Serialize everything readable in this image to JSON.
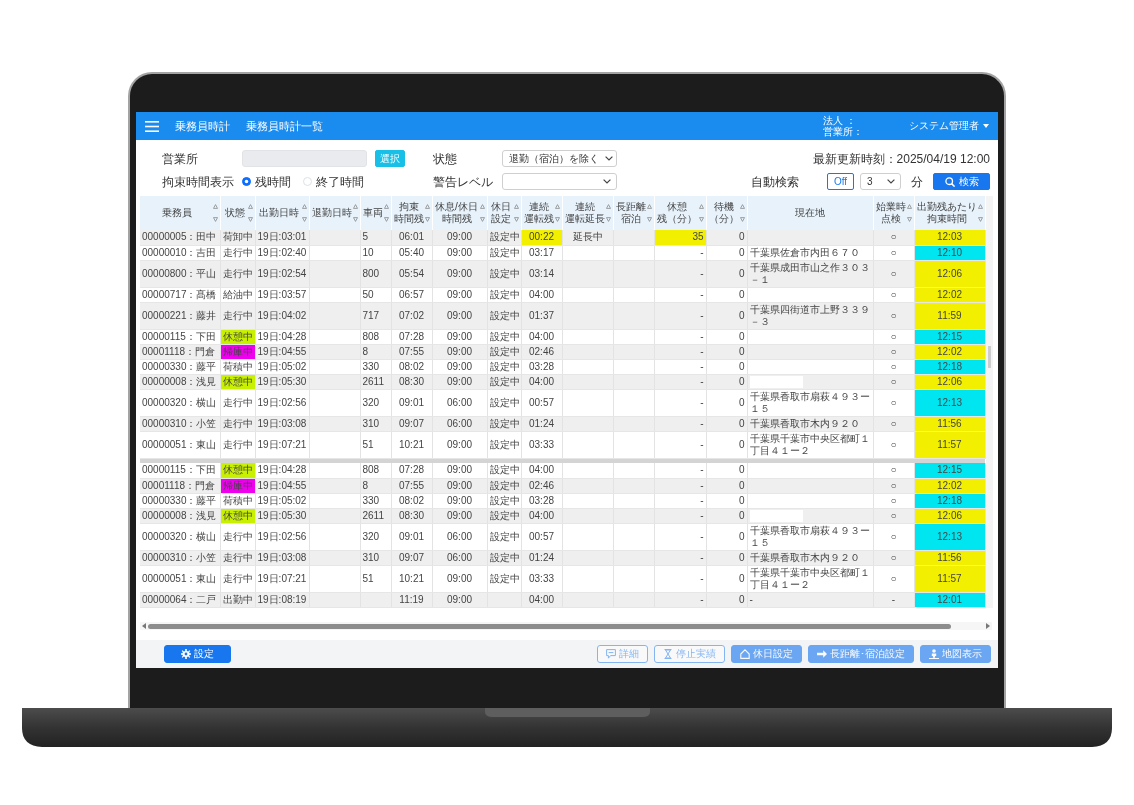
{
  "app_header": {
    "title": "乗務員時計",
    "page_title": "乗務員時計一覧",
    "corporation_label": "法人 ：",
    "office_label": "営業所：",
    "user": "システム管理者"
  },
  "filters": {
    "office": {
      "label": "営業所",
      "select_button": "選択"
    },
    "status": {
      "label": "状態",
      "value": "退勤（宿泊）を除く"
    },
    "last_updated": "最新更新時刻：2025/04/19 12:00",
    "time_display": {
      "label": "拘束時間表示",
      "options": [
        {
          "label": "残時間",
          "selected": true
        },
        {
          "label": "終了時間",
          "selected": false
        }
      ]
    },
    "warning_level": {
      "label": "警告レベル"
    },
    "auto_search": {
      "label": "自動検索",
      "toggle": {
        "label": "Off",
        "on": false
      },
      "interval": "3",
      "unit": "分"
    },
    "search_button": "検索"
  },
  "table": {
    "columns": [
      {
        "lines": [
          "乗務員"
        ],
        "sortable": true
      },
      {
        "lines": [
          "状態"
        ],
        "sortable": true
      },
      {
        "lines": [
          "出勤日時"
        ],
        "sortable": true
      },
      {
        "lines": [
          "退勤日時"
        ],
        "sortable": true
      },
      {
        "lines": [
          "車両"
        ],
        "sortable": true
      },
      {
        "lines": [
          "拘束",
          "時間残"
        ],
        "sortable": true
      },
      {
        "lines": [
          "休息/休日",
          "時間残"
        ],
        "sortable": true
      },
      {
        "lines": [
          "休日",
          "設定"
        ],
        "sortable": true
      },
      {
        "lines": [
          "連続",
          "運転残"
        ],
        "sortable": true
      },
      {
        "lines": [
          "連続",
          "運転延長"
        ],
        "sortable": true
      },
      {
        "lines": [
          "長距離",
          "宿泊"
        ],
        "sortable": true
      },
      {
        "lines": [
          "休憩",
          "残（分）"
        ],
        "sortable": true
      },
      {
        "lines": [
          "待機",
          "（分）"
        ],
        "sortable": true
      },
      {
        "lines": [
          "現在地"
        ],
        "sortable": false
      },
      {
        "lines": [
          "始業時",
          "点検"
        ],
        "sortable": true
      },
      {
        "lines": [
          "出勤残あたり",
          "拘束時間"
        ],
        "sortable": true
      }
    ],
    "sections": [
      {
        "rows": [
          {
            "driver": "00000005：田中",
            "status": "荷卸中",
            "clock_in": "19日:03:01",
            "vehicle": "5",
            "restraint_left": "06:01",
            "rest_left": "09:00",
            "holiday": "設定中",
            "drive_left": {
              "text": "00:22",
              "color": "#f2f000"
            },
            "drive_extension": "延長中",
            "break_left": {
              "text": "35",
              "color": "#f2f000"
            },
            "standby": "0",
            "pre_check": "○",
            "restraint_per_shift": {
              "text": "12:03",
              "color": "#f2f000"
            }
          },
          {
            "driver": "00000010：吉田",
            "status": "走行中",
            "clock_in": "19日:02:40",
            "vehicle": "10",
            "restraint_left": "05:40",
            "rest_left": "09:00",
            "holiday": "設定中",
            "drive_left": "03:17",
            "break_left": "-",
            "standby": "0",
            "location": "千葉県佐倉市内田６７０",
            "pre_check": "○",
            "restraint_per_shift": {
              "text": "12:10",
              "color": "#00e6f0"
            }
          },
          {
            "driver": "00000800：平山",
            "status": "走行中",
            "clock_in": "19日:02:54",
            "vehicle": "800",
            "restraint_left": "05:54",
            "rest_left": "09:00",
            "holiday": "設定中",
            "drive_left": "03:14",
            "break_left": "-",
            "standby": "0",
            "location": "千葉県成田市山之作３０３－１",
            "pre_check": "○",
            "restraint_per_shift": {
              "text": "12:06",
              "color": "#f2f000"
            }
          },
          {
            "driver": "00000717：髙橋",
            "status": "給油中",
            "clock_in": "19日:03:57",
            "vehicle": "50",
            "restraint_left": "06:57",
            "rest_left": "09:00",
            "holiday": "設定中",
            "drive_left": "04:00",
            "break_left": "-",
            "standby": "0",
            "pre_check": "○",
            "restraint_per_shift": {
              "text": "12:02",
              "color": "#f2f000"
            }
          },
          {
            "driver": "00000221：藤井",
            "status": "走行中",
            "clock_in": "19日:04:02",
            "vehicle": "717",
            "restraint_left": "07:02",
            "rest_left": "09:00",
            "holiday": "設定中",
            "drive_left": "01:37",
            "break_left": "-",
            "standby": "0",
            "location": "千葉県四街道市上野３３９－３",
            "pre_check": "○",
            "restraint_per_shift": {
              "text": "11:59",
              "color": "#f2f000"
            }
          },
          {
            "driver": "00000115：下田",
            "status": {
              "text": "休憩中",
              "color": "#c8f000"
            },
            "clock_in": "19日:04:28",
            "vehicle": "808",
            "restraint_left": "07:28",
            "rest_left": "09:00",
            "holiday": "設定中",
            "drive_left": "04:00",
            "break_left": "-",
            "standby": "0",
            "pre_check": "○",
            "restraint_per_shift": {
              "text": "12:15",
              "color": "#00e6f0"
            }
          },
          {
            "driver": "00001118：門倉",
            "status": {
              "text": "帰庫中",
              "color": "#ee00ee"
            },
            "clock_in": "19日:04:55",
            "vehicle": "8",
            "restraint_left": "07:55",
            "rest_left": "09:00",
            "holiday": "設定中",
            "drive_left": "02:46",
            "break_left": "-",
            "standby": "0",
            "pre_check": "○",
            "restraint_per_shift": {
              "text": "12:02",
              "color": "#f2f000"
            }
          },
          {
            "driver": "00000330：藤平",
            "status": "荷積中",
            "clock_in": "19日:05:02",
            "vehicle": "330",
            "restraint_left": "08:02",
            "rest_left": "09:00",
            "holiday": "設定中",
            "drive_left": "03:28",
            "break_left": "-",
            "standby": "0",
            "pre_check": "○",
            "restraint_per_shift": {
              "text": "12:18",
              "color": "#00e6f0"
            }
          },
          {
            "driver": "00000008：浅見",
            "status": {
              "text": "休憩中",
              "color": "#c8f000"
            },
            "clock_in": "19日:05:30",
            "vehicle": "2611",
            "restraint_left": "08:30",
            "rest_left": "09:00",
            "holiday": "設定中",
            "drive_left": "04:00",
            "break_left": "-",
            "standby": "0",
            "location_masked": true,
            "pre_check": "○",
            "restraint_per_shift": {
              "text": "12:06",
              "color": "#f2f000"
            }
          },
          {
            "driver": "00000320：横山",
            "status": "走行中",
            "clock_in": "19日:02:56",
            "vehicle": "320",
            "restraint_left": "09:01",
            "rest_left": "06:00",
            "holiday": "設定中",
            "drive_left": "00:57",
            "break_left": "-",
            "standby": "0",
            "location": "千葉県香取市扇萩４９３ー１５",
            "pre_check": "○",
            "restraint_per_shift": {
              "text": "12:13",
              "color": "#00e6f0"
            }
          },
          {
            "driver": "00000310：小笠",
            "status": "走行中",
            "clock_in": "19日:03:08",
            "vehicle": "310",
            "restraint_left": "09:07",
            "rest_left": "06:00",
            "holiday": "設定中",
            "drive_left": "01:24",
            "break_left": "-",
            "standby": "0",
            "location": "千葉県香取市木内９２０",
            "pre_check": "○",
            "restraint_per_shift": {
              "text": "11:56",
              "color": "#f2f000"
            }
          },
          {
            "driver": "00000051：東山",
            "status": "走行中",
            "clock_in": "19日:07:21",
            "vehicle": "51",
            "restraint_left": "10:21",
            "rest_left": "09:00",
            "holiday": "設定中",
            "drive_left": "03:33",
            "break_left": "-",
            "standby": "0",
            "location": "千葉県千葉市中央区都町１丁目４１ー２",
            "pre_check": "○",
            "restraint_per_shift": {
              "text": "11:57",
              "color": "#f2f000"
            }
          }
        ]
      },
      {
        "rows": [
          {
            "driver": "00000115：下田",
            "status": {
              "text": "休憩中",
              "color": "#c8f000"
            },
            "clock_in": "19日:04:28",
            "vehicle": "808",
            "restraint_left": "07:28",
            "rest_left": "09:00",
            "holiday": "設定中",
            "drive_left": "04:00",
            "break_left": "-",
            "standby": "0",
            "pre_check": "○",
            "restraint_per_shift": {
              "text": "12:15",
              "color": "#00e6f0"
            }
          },
          {
            "driver": "00001118：門倉",
            "status": {
              "text": "帰庫中",
              "color": "#ee00ee"
            },
            "clock_in": "19日:04:55",
            "vehicle": "8",
            "restraint_left": "07:55",
            "rest_left": "09:00",
            "holiday": "設定中",
            "drive_left": "02:46",
            "break_left": "-",
            "standby": "0",
            "pre_check": "○",
            "restraint_per_shift": {
              "text": "12:02",
              "color": "#f2f000"
            }
          },
          {
            "driver": "00000330：藤平",
            "status": "荷積中",
            "clock_in": "19日:05:02",
            "vehicle": "330",
            "restraint_left": "08:02",
            "rest_left": "09:00",
            "holiday": "設定中",
            "drive_left": "03:28",
            "break_left": "-",
            "standby": "0",
            "pre_check": "○",
            "restraint_per_shift": {
              "text": "12:18",
              "color": "#00e6f0"
            }
          },
          {
            "driver": "00000008：浅見",
            "status": {
              "text": "休憩中",
              "color": "#c8f000"
            },
            "clock_in": "19日:05:30",
            "vehicle": "2611",
            "restraint_left": "08:30",
            "rest_left": "09:00",
            "holiday": "設定中",
            "drive_left": "04:00",
            "break_left": "-",
            "standby": "0",
            "location_masked": true,
            "pre_check": "○",
            "restraint_per_shift": {
              "text": "12:06",
              "color": "#f2f000"
            }
          },
          {
            "driver": "00000320：横山",
            "status": "走行中",
            "clock_in": "19日:02:56",
            "vehicle": "320",
            "restraint_left": "09:01",
            "rest_left": "06:00",
            "holiday": "設定中",
            "drive_left": "00:57",
            "break_left": "-",
            "standby": "0",
            "location": "千葉県香取市扇萩４９３ー１５",
            "pre_check": "○",
            "restraint_per_shift": {
              "text": "12:13",
              "color": "#00e6f0"
            }
          },
          {
            "driver": "00000310：小笠",
            "status": "走行中",
            "clock_in": "19日:03:08",
            "vehicle": "310",
            "restraint_left": "09:07",
            "rest_left": "06:00",
            "holiday": "設定中",
            "drive_left": "01:24",
            "break_left": "-",
            "standby": "0",
            "location": "千葉県香取市木内９２０",
            "pre_check": "○",
            "restraint_per_shift": {
              "text": "11:56",
              "color": "#f2f000"
            }
          },
          {
            "driver": "00000051：東山",
            "status": "走行中",
            "clock_in": "19日:07:21",
            "vehicle": "51",
            "restraint_left": "10:21",
            "rest_left": "09:00",
            "holiday": "設定中",
            "drive_left": "03:33",
            "break_left": "-",
            "standby": "0",
            "location": "千葉県千葉市中央区都町１丁目４１ー２",
            "pre_check": "○",
            "restraint_per_shift": {
              "text": "11:57",
              "color": "#f2f000"
            }
          },
          {
            "driver": "00000064：二戸",
            "status": "出勤中",
            "clock_in": "19日:08:19",
            "restraint_left": "11:19",
            "rest_left": "09:00",
            "drive_left": "04:00",
            "break_left": "-",
            "standby": "0",
            "location": "-",
            "pre_check": "-",
            "restraint_per_shift": {
              "text": "12:01",
              "color": "#00e6f0"
            }
          }
        ]
      }
    ]
  },
  "footer": {
    "left_buttons": [
      {
        "label": "設定",
        "kind": "solid",
        "disabled": false
      }
    ],
    "right_buttons": [
      {
        "label": "詳細",
        "kind": "outline",
        "disabled": true
      },
      {
        "label": "停止実績",
        "kind": "outline",
        "disabled": true
      },
      {
        "label": "休日設定",
        "kind": "solid",
        "disabled": true
      },
      {
        "label": "長距離･宿泊設定",
        "kind": "solid",
        "disabled": true
      },
      {
        "label": "地図表示",
        "kind": "solid",
        "disabled": true
      }
    ]
  }
}
